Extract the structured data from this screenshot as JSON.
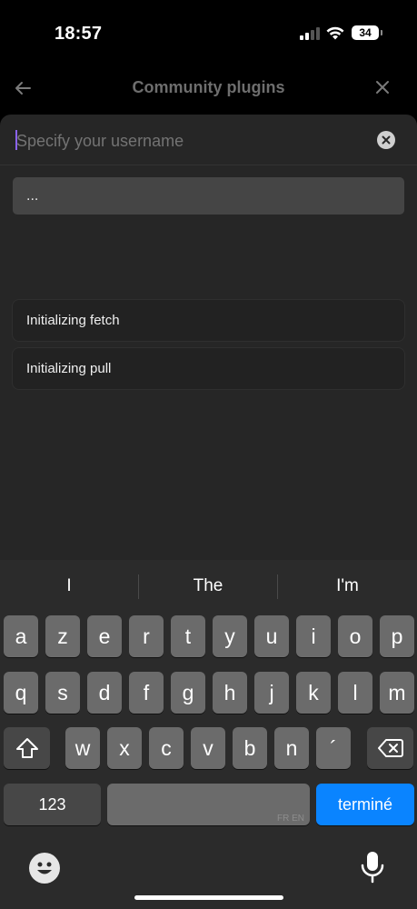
{
  "status": {
    "time": "18:57",
    "battery": "34"
  },
  "nav": {
    "title": "Community plugins"
  },
  "search": {
    "placeholder": "Specify your username",
    "value": ""
  },
  "suggestion": {
    "text": "..."
  },
  "notices": [
    "Initializing fetch",
    "Initializing pull"
  ],
  "keyboard": {
    "predictions": [
      "I",
      "The",
      "I'm"
    ],
    "row1": [
      "a",
      "z",
      "e",
      "r",
      "t",
      "y",
      "u",
      "i",
      "o",
      "p"
    ],
    "row2": [
      "q",
      "s",
      "d",
      "f",
      "g",
      "h",
      "j",
      "k",
      "l",
      "m"
    ],
    "row3": [
      "w",
      "x",
      "c",
      "v",
      "b",
      "n",
      "´"
    ],
    "numbers_label": "123",
    "return_label": "terminé",
    "space_lang": "FR EN"
  },
  "colors": {
    "accent": "#0a84ff",
    "caret": "#8a63f0",
    "modal": "#262626",
    "key": "#6b6b6b"
  }
}
